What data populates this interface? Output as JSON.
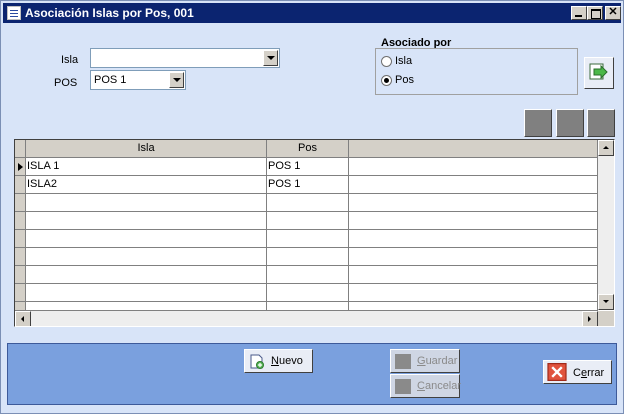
{
  "window": {
    "title": "Asociación Islas por Pos, 001"
  },
  "filters": {
    "isla_label": "Isla",
    "isla_value": "",
    "pos_label": "POS",
    "pos_value": "POS 1"
  },
  "asociado": {
    "title": "Asociado por",
    "options": [
      {
        "label": "Isla",
        "selected": false
      },
      {
        "label": "Pos",
        "selected": true
      }
    ]
  },
  "grid": {
    "columns": [
      "Isla",
      "Pos",
      ""
    ],
    "rows": [
      {
        "isla": "ISLA 1",
        "pos": "POS 1"
      },
      {
        "isla": "ISLA2",
        "pos": "POS 1"
      },
      {
        "isla": "",
        "pos": ""
      },
      {
        "isla": "",
        "pos": ""
      },
      {
        "isla": "",
        "pos": ""
      },
      {
        "isla": "",
        "pos": ""
      },
      {
        "isla": "",
        "pos": ""
      },
      {
        "isla": "",
        "pos": ""
      },
      {
        "isla": "",
        "pos": ""
      }
    ]
  },
  "buttons": {
    "nuevo": {
      "accel": "N",
      "rest": "uevo"
    },
    "guardar": {
      "accel": "G",
      "rest": "uardar"
    },
    "cancelar": {
      "accel": "C",
      "rest": "ancelar"
    },
    "cerrar": {
      "prefix": "C",
      "accel": "e",
      "rest": "rrar"
    }
  },
  "icons": {
    "nuevo": "new-document-icon",
    "cerrar": "close-x-icon",
    "apply": "link-arrow-icon"
  },
  "colors": {
    "titlebar": "#0b2470",
    "background": "#d8e4f8",
    "bottom_bar": "#7aa0de",
    "cerrar_icon": "#e0533d"
  }
}
